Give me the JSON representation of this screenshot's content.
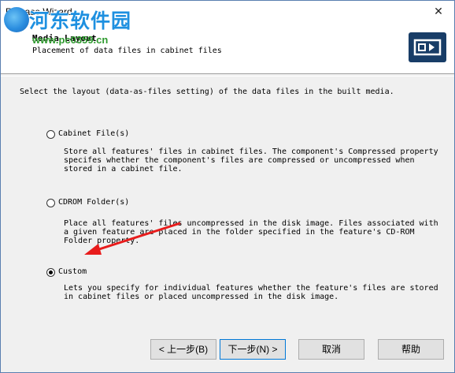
{
  "window": {
    "title": "Release Wizard",
    "close_label": "✕"
  },
  "header": {
    "title": "Media Layout",
    "subtitle": "Placement of data files in cabinet files"
  },
  "watermark": {
    "text_cn": "河东软件园",
    "url": "www.pc0359.cn"
  },
  "instruction": "Select the layout (data-as-files setting) of the data files in the built media.",
  "options": [
    {
      "label": "Cabinet File(s)",
      "checked": false,
      "description": "Store all features' files in cabinet files. The component's Compressed property\nspecifes whether the component's files are compressed or uncompressed when\nstored in a cabinet file."
    },
    {
      "label": "CDROM Folder(s)",
      "checked": false,
      "description": "Place all features' files uncompressed in the disk image. Files associated with\na given feature are placed in the folder specified in the feature's CD-ROM\nFolder property."
    },
    {
      "label": "Custom",
      "checked": true,
      "description": "Lets you specify for individual features whether the feature's files are stored\nin cabinet files or placed uncompressed in the disk image."
    }
  ],
  "buttons": {
    "back": "< 上一步(B)",
    "next": "下一步(N) >",
    "cancel": "取消",
    "help": "帮助"
  },
  "colors": {
    "logo_bg": "#183d67",
    "arrow": "#e81c1c",
    "focus_border": "#0078d7"
  }
}
